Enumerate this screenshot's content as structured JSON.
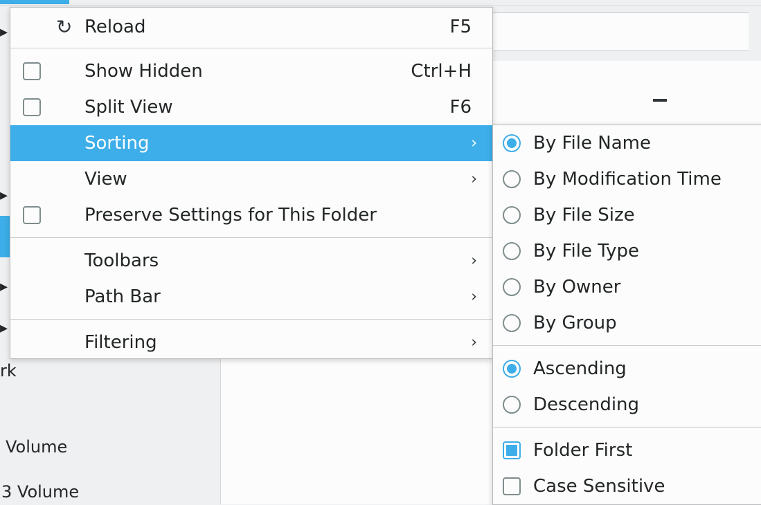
{
  "sidebar": {
    "items": [
      "rk",
      "Volume",
      "3 Volume"
    ]
  },
  "main_menu": {
    "reload": {
      "label": "Reload",
      "shortcut": "F5",
      "icon": "reload-icon"
    },
    "show_hidden": {
      "label": "Show Hidden",
      "shortcut": "Ctrl+H",
      "checked": false
    },
    "split_view": {
      "label": "Split View",
      "shortcut": "F6",
      "checked": false
    },
    "sorting": {
      "label": "Sorting",
      "arrow": "›"
    },
    "view": {
      "label": "View",
      "arrow": "›"
    },
    "preserve": {
      "label": "Preserve Settings for This Folder",
      "checked": false
    },
    "toolbars": {
      "label": "Toolbars",
      "arrow": "›"
    },
    "path_bar": {
      "label": "Path Bar",
      "arrow": "›"
    },
    "filtering": {
      "label": "Filtering",
      "arrow": "›"
    }
  },
  "sorting_menu": {
    "by_file_name": {
      "label": "By File Name",
      "selected": true
    },
    "by_modification_time": {
      "label": "By Modification Time",
      "selected": false
    },
    "by_file_size": {
      "label": "By File Size",
      "selected": false
    },
    "by_file_type": {
      "label": "By File Type",
      "selected": false
    },
    "by_owner": {
      "label": "By Owner",
      "selected": false
    },
    "by_group": {
      "label": "By Group",
      "selected": false
    },
    "ascending": {
      "label": "Ascending",
      "selected": true
    },
    "descending": {
      "label": "Descending",
      "selected": false
    },
    "folder_first": {
      "label": "Folder First",
      "checked": true
    },
    "case_sensitive": {
      "label": "Case Sensitive",
      "checked": false
    }
  },
  "colors": {
    "accent": "#3daee9",
    "menu_bg": "#fcfcfc",
    "window_bg": "#eff0f1",
    "text": "#232627"
  }
}
